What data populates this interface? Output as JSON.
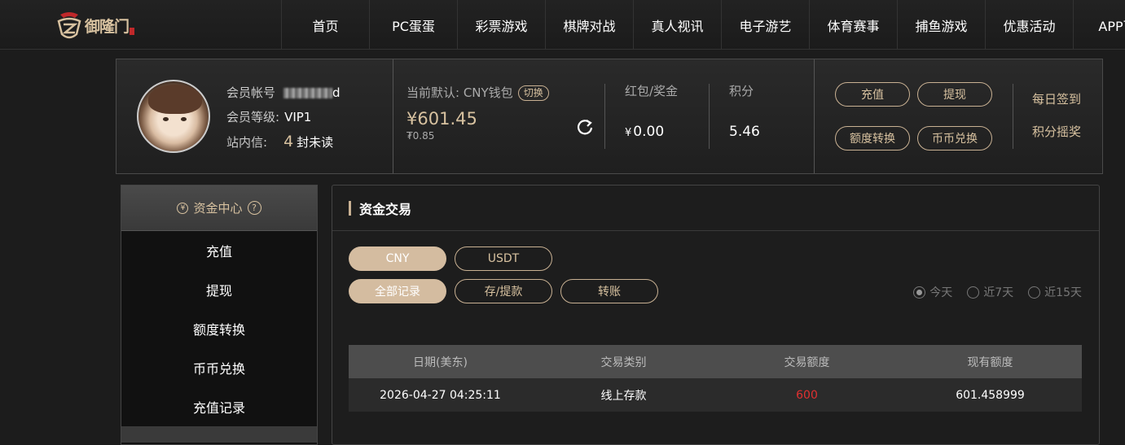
{
  "brand": {
    "logo_text": "御隆门"
  },
  "nav": [
    "首页",
    "PC蛋蛋",
    "彩票游戏",
    "棋牌对战",
    "真人视讯",
    "电子游艺",
    "体育赛事",
    "捕鱼游戏",
    "优惠活动",
    "APP下"
  ],
  "account": {
    "member_label": "会员帐号",
    "member_suffix": "d",
    "level_label": "会员等级:",
    "level_value": "VIP1",
    "mail_label": "站内信:",
    "mail_count": "4",
    "mail_suffix": "封未读",
    "wallet_label": "当前默认: CNY钱包",
    "switch_label": "切换",
    "balance": "¥601.45",
    "balance_sub": "₮0.85",
    "redpacket_label": "红包/奖金",
    "redpacket_currency": "¥",
    "redpacket_value": "0.00",
    "points_label": "积分",
    "points_value": "5.46",
    "actions": {
      "deposit": "充值",
      "withdraw": "提现",
      "transfer": "额度转换",
      "exchange": "币币兑换"
    },
    "daily_signin": "每日签到",
    "points_lottery": "积分摇奖"
  },
  "sidebar": {
    "header": "资金中心",
    "items": [
      "充值",
      "提现",
      "额度转换",
      "币币兑换",
      "充值记录"
    ]
  },
  "panel": {
    "title": "资金交易",
    "currency_tabs": [
      "CNY",
      "USDT"
    ],
    "record_tabs": [
      "全部记录",
      "存/提款",
      "转账"
    ],
    "ranges": [
      "今天",
      "近7天",
      "近15天"
    ],
    "columns": [
      "日期(美东)",
      "交易类别",
      "交易额度",
      "现有额度"
    ],
    "rows": [
      {
        "date": "2026-04-27 04:25:11",
        "type": "线上存款",
        "amount": "600",
        "balance": "601.458999"
      }
    ]
  },
  "colors": {
    "accent": "#d8c2a0",
    "negative": "#e03030"
  }
}
